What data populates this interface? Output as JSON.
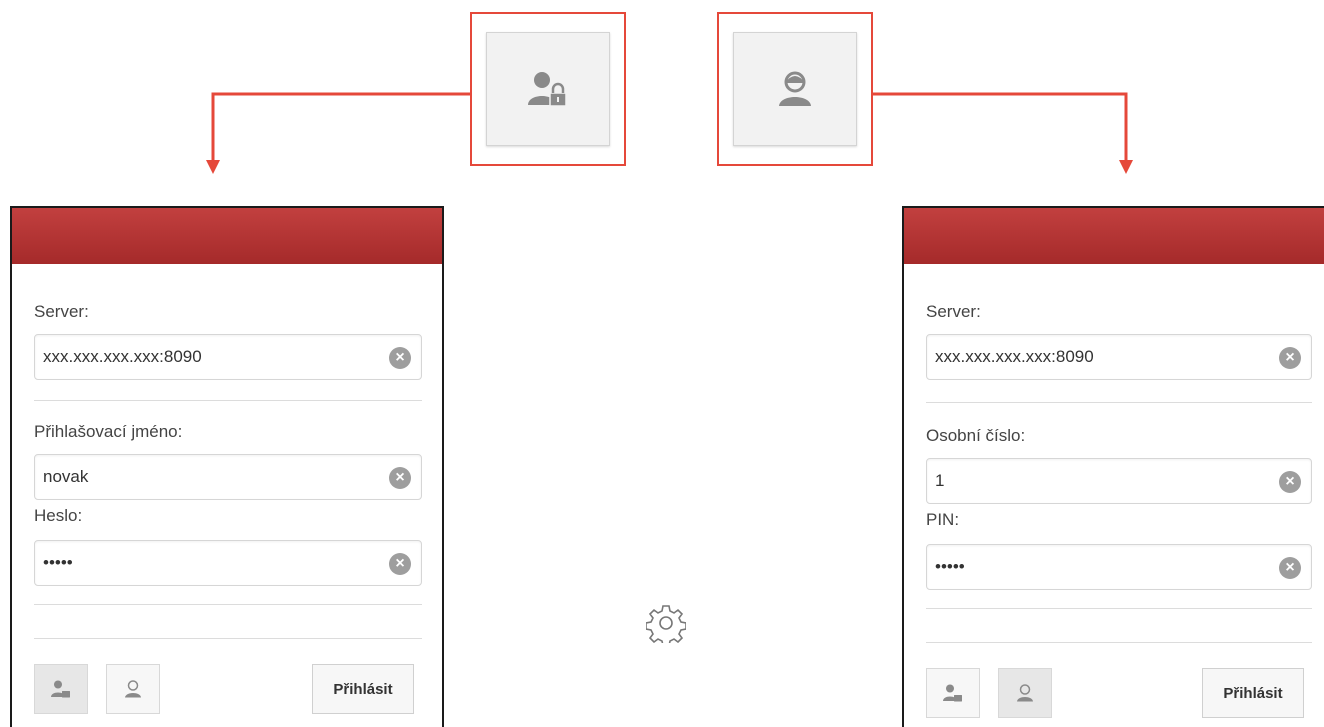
{
  "callouts": {
    "user_lock_icon": "user-lock-icon",
    "user_icon": "user-icon"
  },
  "left_panel": {
    "server_label": "Server:",
    "server_value": "xxx.xxx.xxx.xxx:8090",
    "username_label": "Přihlašovací jméno:",
    "username_value": "novak",
    "password_label": "Heslo:",
    "password_value": "•••••",
    "login_button": "Přihlásit"
  },
  "right_panel": {
    "server_label": "Server:",
    "server_value": "xxx.xxx.xxx.xxx:8090",
    "personal_number_label": "Osobní číslo:",
    "personal_number_value": "1",
    "pin_label": "PIN:",
    "pin_value": "•••••",
    "login_button": "Přihlásit"
  },
  "colors": {
    "accent_red": "#e5483a",
    "header_red": "#b33535"
  }
}
